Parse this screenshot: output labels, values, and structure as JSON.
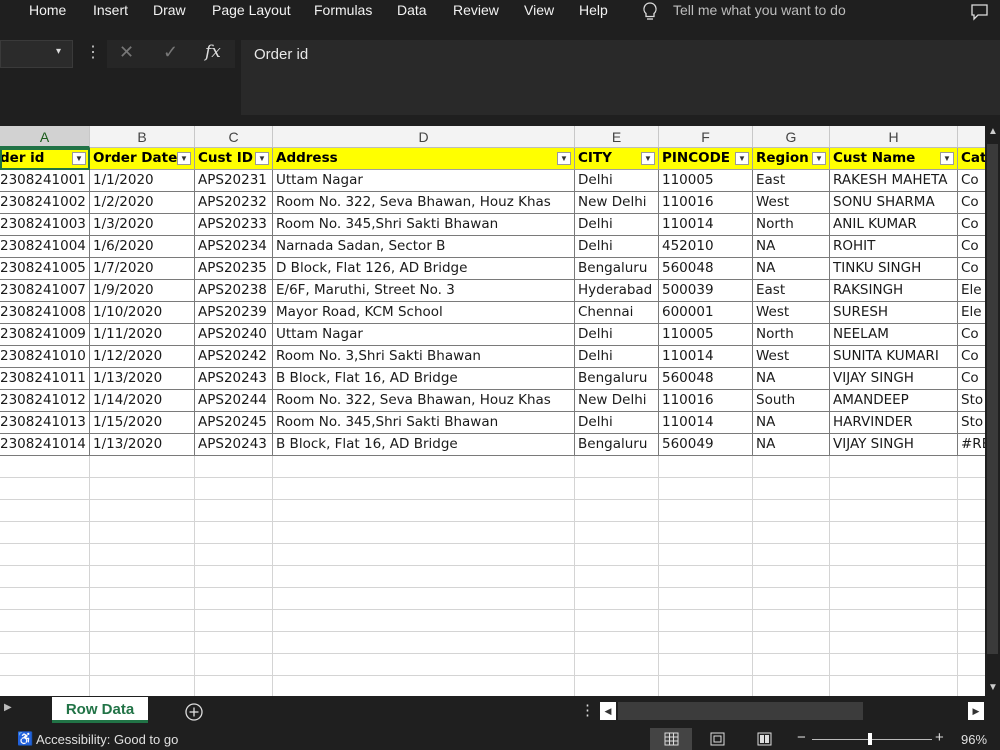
{
  "menu": [
    "Home",
    "Insert",
    "Draw",
    "Page Layout",
    "Formulas",
    "Data",
    "Review",
    "View",
    "Help"
  ],
  "tell_me": "Tell me what you want to do",
  "formula": {
    "fx": "fx",
    "content": "Order id"
  },
  "columns": [
    "A",
    "B",
    "C",
    "D",
    "E",
    "F",
    "G",
    "H",
    ""
  ],
  "headers": [
    "der id",
    "Order Date",
    "Cust ID",
    "Address",
    "CITY",
    "PINCODE",
    "Region",
    "Cust Name",
    "Cat"
  ],
  "rows": [
    [
      "2308241001",
      "1/1/2020",
      "APS20231",
      "Uttam Nagar",
      " Delhi",
      "110005",
      "East",
      "RAKESH MAHETA",
      "Co"
    ],
    [
      "2308241002",
      "1/2/2020",
      "APS20232",
      "Room No. 322,  Seva Bhawan,  Houz Khas",
      "New Delhi",
      "110016",
      "West",
      "SONU SHARMA",
      "Co"
    ],
    [
      "2308241003",
      "1/3/2020",
      "APS20233",
      "Room No. 345,Shri Sakti Bhawan",
      "Delhi",
      "110014",
      "North",
      "ANIL KUMAR",
      "Co"
    ],
    [
      "2308241004",
      "1/6/2020",
      "APS20234",
      "Narnada Sadan,  Sector B",
      "Delhi",
      "452010",
      "NA",
      "ROHIT",
      "Co"
    ],
    [
      "2308241005",
      "1/7/2020",
      "APS20235",
      "D Block, Flat 126, AD Bridge",
      "Bengaluru",
      "560048",
      "NA",
      "TINKU SINGH",
      "Co"
    ],
    [
      "2308241007",
      "1/9/2020",
      "APS20238",
      "E/6F, Maruthi, Street No. 3",
      "Hyderabad",
      "500039",
      "East",
      "RAKSINGH",
      "Ele"
    ],
    [
      "2308241008",
      "1/10/2020",
      "APS20239",
      "Mayor Road,  KCM School",
      "Chennai",
      "600001",
      "West",
      "SURESH",
      "Ele"
    ],
    [
      "2308241009",
      "1/11/2020",
      "APS20240",
      "Uttam Nagar",
      "Delhi",
      "110005",
      "North",
      "NEELAM",
      "Co"
    ],
    [
      "2308241010",
      "1/12/2020",
      "APS20242",
      "Room No. 3,Shri Sakti Bhawan",
      "Delhi",
      "110014",
      "West",
      "SUNITA KUMARI",
      "Co"
    ],
    [
      "2308241011",
      "1/13/2020",
      "APS20243",
      "B Block, Flat 16, AD Bridge",
      "Bengaluru",
      "560048",
      "NA",
      "VIJAY SINGH",
      "Co"
    ],
    [
      "2308241012",
      "1/14/2020",
      "APS20244",
      "Room No. 322,  Seva Bhawan,  Houz Khas",
      "New Delhi",
      "110016",
      "South",
      "AMANDEEP",
      "Sto"
    ],
    [
      "2308241013",
      "1/15/2020",
      "APS20245",
      "Room No. 345,Shri Sakti Bhawan",
      "Delhi",
      "110014",
      "NA",
      "HARVINDER",
      "Sto"
    ],
    [
      "2308241014",
      "1/13/2020",
      "APS20243",
      "B Block, Flat 16, AD Bridge",
      "Bengaluru",
      "560049",
      "NA",
      "VIJAY SINGH",
      "#RE"
    ]
  ],
  "sheet_tab": "Row Data",
  "status": {
    "accessibility": "Accessibility: Good to go",
    "zoom": "96%"
  }
}
